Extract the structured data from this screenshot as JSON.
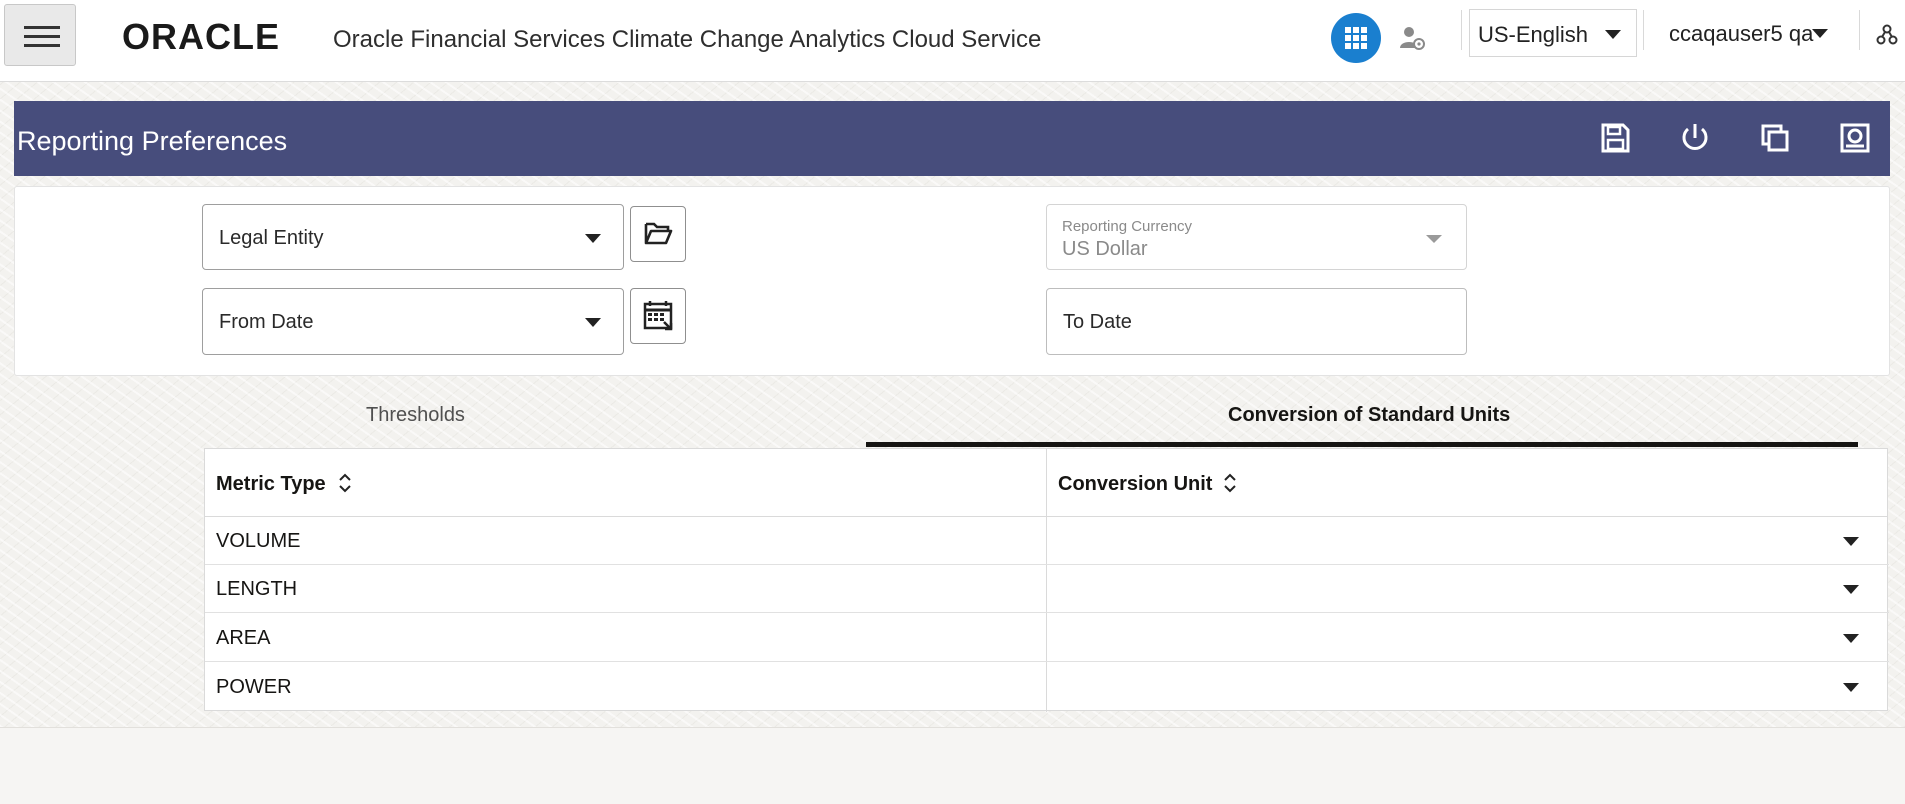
{
  "header": {
    "logo_text": "ORACLE",
    "app_title": "Oracle Financial Services Climate Change Analytics Cloud Service",
    "language": "US-English",
    "user": "ccaqauser5 qa"
  },
  "page": {
    "title": "Reporting Preferences",
    "toolbar_icons": [
      "save-icon",
      "reset-icon",
      "copy-icon",
      "preview-icon"
    ]
  },
  "filters": {
    "legal_entity": "Legal Entity",
    "from_date": "From Date",
    "reporting_currency_label": "Reporting Currency",
    "reporting_currency_value": "US Dollar",
    "to_date": "To Date"
  },
  "tabs": [
    {
      "label": "Thresholds",
      "active": false
    },
    {
      "label": "Conversion of Standard Units",
      "active": true
    }
  ],
  "table": {
    "columns": [
      "Metric Type",
      "Conversion Unit"
    ],
    "rows": [
      {
        "metric_type": "VOLUME",
        "conversion_unit": ""
      },
      {
        "metric_type": "LENGTH",
        "conversion_unit": ""
      },
      {
        "metric_type": "AREA",
        "conversion_unit": ""
      },
      {
        "metric_type": "POWER",
        "conversion_unit": ""
      }
    ]
  },
  "colors": {
    "title_bar": "#474d7c",
    "apps_button": "#1a7fcf",
    "active_tab_underline": "#161513"
  }
}
